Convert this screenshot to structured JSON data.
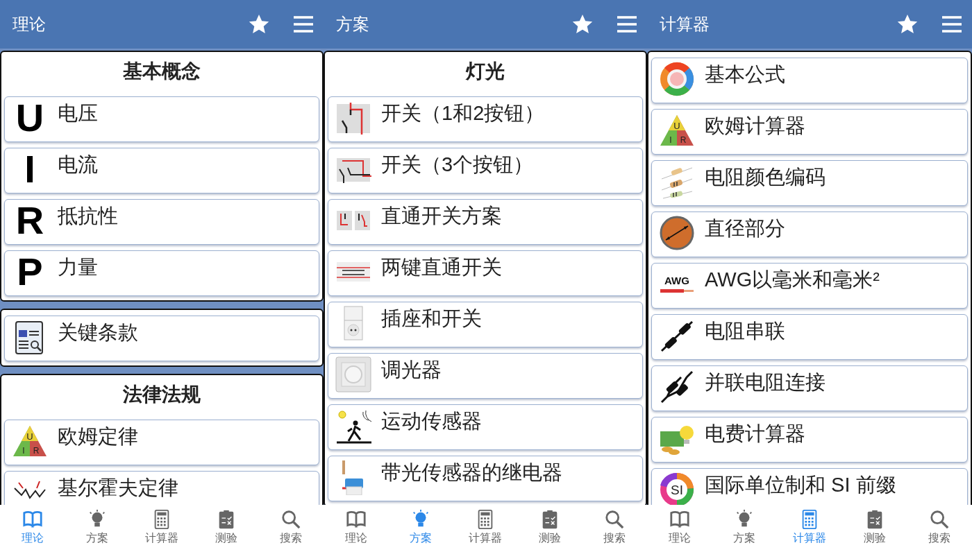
{
  "panels": [
    {
      "title": "理论",
      "sections": [
        {
          "heading": "基本概念",
          "items": [
            {
              "label": "电压",
              "kind": "letter",
              "letter": "U"
            },
            {
              "label": "电流",
              "kind": "letter",
              "letter": "I"
            },
            {
              "label": "抵抗性",
              "kind": "letter",
              "letter": "R"
            },
            {
              "label": "力量",
              "kind": "letter",
              "letter": "P"
            }
          ]
        },
        {
          "items": [
            {
              "label": "关键条款",
              "kind": "glossary"
            }
          ]
        },
        {
          "heading": "法律法规",
          "items": [
            {
              "label": "欧姆定律",
              "kind": "ohm-triangle",
              "icon_letters": [
                "U",
                "I",
                "R"
              ]
            },
            {
              "label": "基尔霍夫定律",
              "kind": "kirchhoff"
            }
          ]
        }
      ],
      "tabs": [
        {
          "label": "理论",
          "kind": "book",
          "selected": true
        },
        {
          "label": "方案",
          "kind": "bulb",
          "selected": false
        },
        {
          "label": "计算器",
          "kind": "calculator",
          "selected": false
        },
        {
          "label": "测验",
          "kind": "clipboard",
          "selected": false
        },
        {
          "label": "搜索",
          "kind": "search",
          "selected": false
        }
      ]
    },
    {
      "title": "方案",
      "sections": [
        {
          "heading": "灯光",
          "items": [
            {
              "label": "开关（1和2按钮）",
              "kind": "switch-one"
            },
            {
              "label": "开关（3个按钮）",
              "kind": "switch-three"
            },
            {
              "label": "直通开关方案",
              "kind": "passthrough"
            },
            {
              "label": "两键直通开关",
              "kind": "two-key"
            },
            {
              "label": "插座和开关",
              "kind": "socket"
            },
            {
              "label": "调光器",
              "kind": "dimmer"
            },
            {
              "label": "运动传感器",
              "kind": "motion"
            },
            {
              "label": "带光传感器的继电器",
              "kind": "relay"
            }
          ]
        }
      ],
      "tabs": [
        {
          "label": "理论",
          "kind": "book",
          "selected": false
        },
        {
          "label": "方案",
          "kind": "bulb",
          "selected": true
        },
        {
          "label": "计算器",
          "kind": "calculator",
          "selected": false
        },
        {
          "label": "测验",
          "kind": "clipboard",
          "selected": false
        },
        {
          "label": "搜索",
          "kind": "search",
          "selected": false
        }
      ]
    },
    {
      "title": "计算器",
      "sections": [
        {
          "items": [
            {
              "label": "基本公式",
              "kind": "wheel"
            },
            {
              "label": "欧姆计算器",
              "kind": "ohm-triangle",
              "icon_letters": [
                "U",
                "I",
                "R"
              ]
            },
            {
              "label": "电阻颜色编码",
              "kind": "resistors"
            },
            {
              "label": "直径部分",
              "kind": "diameter"
            },
            {
              "label": "AWG以毫米和毫米²",
              "kind": "awg",
              "icon_text": "AWG"
            },
            {
              "label": "电阻串联",
              "kind": "series"
            },
            {
              "label": "并联电阻连接",
              "kind": "parallel"
            },
            {
              "label": "电费计算器",
              "kind": "cost"
            },
            {
              "label": "国际单位制和 SI 前缀",
              "kind": "si",
              "icon_text": "SI"
            }
          ]
        }
      ],
      "tabs": [
        {
          "label": "理论",
          "kind": "book",
          "selected": false
        },
        {
          "label": "方案",
          "kind": "bulb",
          "selected": false
        },
        {
          "label": "计算器",
          "kind": "calculator",
          "selected": true
        },
        {
          "label": "测验",
          "kind": "clipboard",
          "selected": false
        },
        {
          "label": "搜索",
          "kind": "search",
          "selected": false
        }
      ]
    }
  ]
}
